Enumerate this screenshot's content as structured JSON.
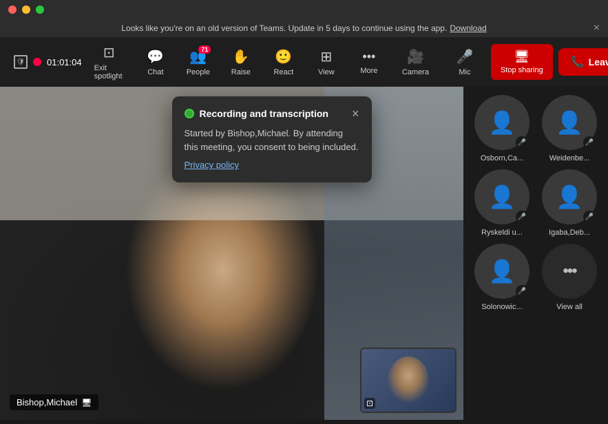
{
  "titlebar": {
    "traffic_lights": [
      "red",
      "yellow",
      "green"
    ]
  },
  "banner": {
    "text": "Looks like you're on an old version of Teams. Update in 5 days to continue using the app.",
    "link_text": "Download",
    "close_label": "×"
  },
  "toolbar": {
    "timer": "01:01:04",
    "items": [
      {
        "id": "exit-spotlight",
        "icon": "⊡",
        "label": "Exit spotlight"
      },
      {
        "id": "chat",
        "icon": "💬",
        "label": "Chat"
      },
      {
        "id": "people",
        "icon": "👥",
        "label": "People",
        "badge": "71"
      },
      {
        "id": "raise",
        "icon": "✋",
        "label": "Raise"
      },
      {
        "id": "react",
        "icon": "🙂",
        "label": "React"
      },
      {
        "id": "view",
        "icon": "⊞",
        "label": "View"
      },
      {
        "id": "more",
        "icon": "···",
        "label": "More"
      }
    ],
    "camera_label": "Camera",
    "mic_label": "Mic",
    "stop_sharing_label": "Stop sharing",
    "leave_label": "Leave"
  },
  "recording_popup": {
    "title": "Recording and transcription",
    "text": "Started by Bishop,Michael. By attending this meeting, you consent to being included.",
    "link": "Privacy policy",
    "close_label": "×"
  },
  "participants": [
    {
      "id": "osborn",
      "name": "Osborn,Ca...",
      "mic": "🎤"
    },
    {
      "id": "weidenbe",
      "name": "Weidenbe...",
      "mic": "🎤"
    },
    {
      "id": "ryskeldi",
      "name": "Ryskeldi u...",
      "mic": "🎤"
    },
    {
      "id": "igaba",
      "name": "Igaba,Deb...",
      "mic": "🎤"
    },
    {
      "id": "solonowic",
      "name": "Solonowic...",
      "mic": "🎤"
    }
  ],
  "view_all_label": "View all",
  "main_speaker": {
    "name": "Bishop,Michael"
  }
}
